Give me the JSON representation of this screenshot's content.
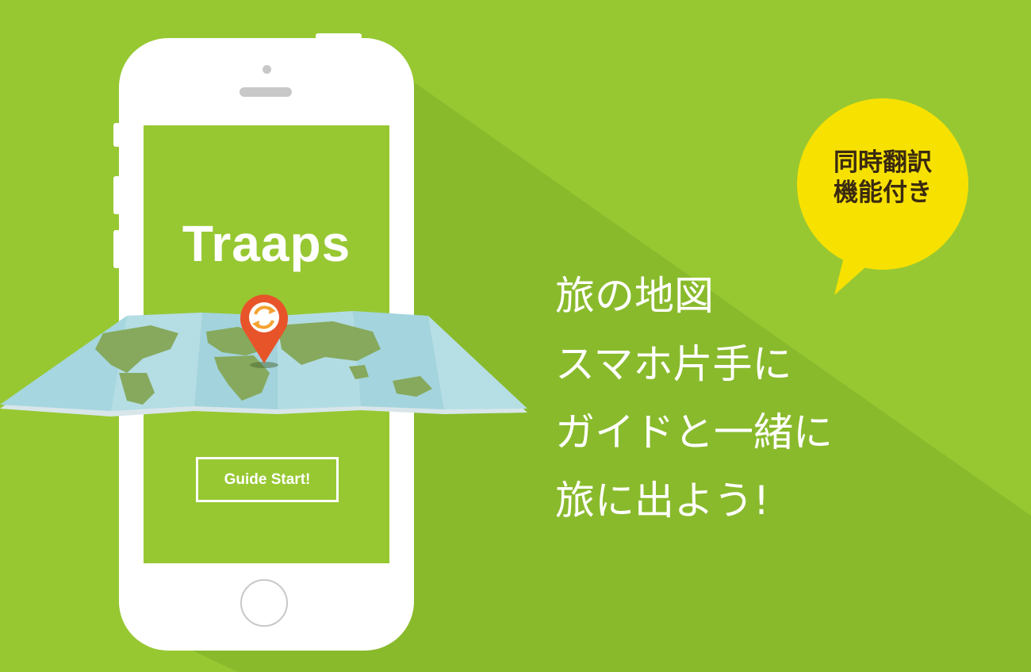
{
  "colors": {
    "background": "#97c832",
    "accent_yellow": "#f7e100",
    "pin": "#e8542a",
    "map_water": "#a8d8e0",
    "map_land": "#88a860"
  },
  "phone": {
    "app_title": "Traaps",
    "guide_button_label": "Guide Start!"
  },
  "headline": {
    "lines": [
      "旅の地図",
      "スマホ片手に",
      "ガイドと一緒に",
      "旅に出よう!"
    ]
  },
  "badge": {
    "line1": "同時翻訳",
    "line2": "機能付き"
  },
  "icons": {
    "pin": "map-pin-icon",
    "refresh": "refresh-icon",
    "map": "world-map-icon"
  }
}
